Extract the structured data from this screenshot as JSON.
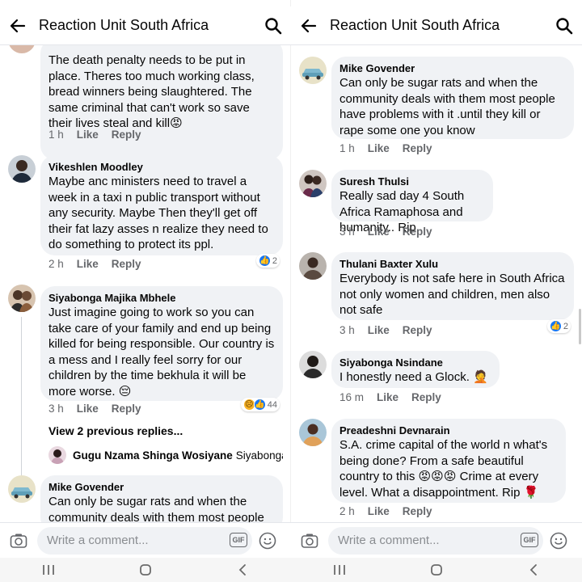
{
  "left_panel": {
    "header": {
      "title": "Reaction Unit South Africa"
    },
    "comments": [
      {
        "author": "",
        "text": "The death penalty needs to be put in place.  Theres too much working class, bread winners being slaughtered. The same criminal that can't work so save their lives steal and kill😡",
        "time": "1 h",
        "like": "Like",
        "reply": "Reply",
        "reaction_count": ""
      },
      {
        "author": "Vikeshlen Moodley",
        "text": "Maybe anc ministers need to travel a week in a taxi n public transport without any security.  Maybe Then they'll get off their fat lazy asses n realize they need to do something to protect its ppl.",
        "time": "2 h",
        "like": "Like",
        "reply": "Reply",
        "reaction_count": "2"
      },
      {
        "author": "Siyabonga Majika Mbhele",
        "text": "Just imagine going to work so you can take care of your family and end up being killed for being responsible. Our country is a mess and I really feel sorry for our children by the time bekhula it will be more worse. 😔",
        "time": "3 h",
        "like": "Like",
        "reply": "Reply",
        "reaction_count": "44"
      },
      {
        "author": "Mike Govender",
        "text": "Can only be sugar rats and when the community deals with them most people"
      }
    ],
    "view_previous": "View 2 previous replies...",
    "reply_preview": {
      "author": "Gugu Nzama Shinga Wosiyane",
      "snippet": "Siyabonga..."
    },
    "composer": {
      "placeholder": "Write a comment...",
      "gif": "GIF"
    }
  },
  "right_panel": {
    "header": {
      "title": "Reaction Unit South Africa"
    },
    "comments": [
      {
        "author": "Mike Govender",
        "text": "Can only be sugar rats and when the community deals with them most people have problems with it .until they kill or rape some one you know",
        "time": "1 h",
        "like": "Like",
        "reply": "Reply",
        "reaction_count": ""
      },
      {
        "author": "Suresh Thulsi",
        "text": "Really sad day 4 South Africa Ramaphosa and humanity.. Rip",
        "time": "3 h",
        "like": "Like",
        "reply": "Reply",
        "reaction_count": ""
      },
      {
        "author": "Thulani Baxter Xulu",
        "text": "Everybody is not safe here in South Africa not only women and children, men also not safe",
        "time": "3 h",
        "like": "Like",
        "reply": "Reply",
        "reaction_count": "2"
      },
      {
        "author": "Siyabonga Nsindane",
        "text": "I honestly need a Glock. 🤦",
        "time": "16 m",
        "like": "Like",
        "reply": "Reply",
        "reaction_count": ""
      },
      {
        "author": "Preadeshni Devnarain",
        "text": "S.A. crime capital of the world n what's being done?   From a safe beautiful country to this  😡😡😡   Crime at every level.   What a disappointment.  Rip 🌹",
        "time": "2 h",
        "like": "Like",
        "reply": "Reply",
        "reaction_count": ""
      }
    ],
    "composer": {
      "placeholder": "Write a comment...",
      "gif": "GIF"
    }
  },
  "icons": {
    "back": "arrow-left-icon",
    "search": "magnifier-icon",
    "camera": "camera-icon",
    "gif": "gif-icon",
    "emoji": "smiley-icon",
    "nav": [
      "recent-apps-icon",
      "home-icon",
      "back-chevron-icon"
    ]
  },
  "colors": {
    "bubble": "#f0f2f5",
    "meta_text": "#65676b",
    "like_blue": "#1877f2",
    "text": "#050505"
  }
}
